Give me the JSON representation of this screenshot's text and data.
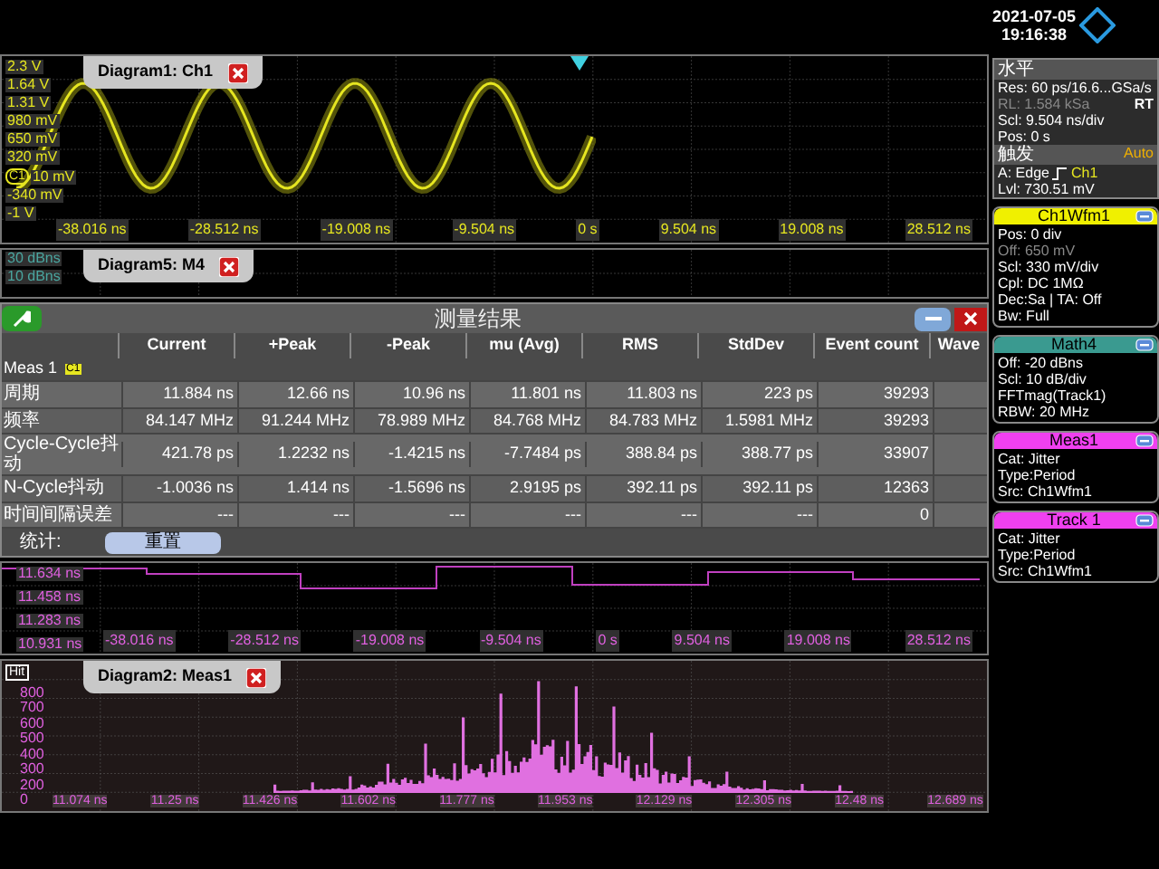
{
  "waveform_diagram": {
    "title": "Diagram1: Ch1",
    "channel_marker": "C1",
    "y_labels": [
      "2.3 V",
      "1.64 V",
      "1.31 V",
      "980 mV",
      "650 mV",
      "320 mV",
      "10 mV",
      "-340 mV",
      "-1 V"
    ],
    "x_labels": [
      "-38.016 ns",
      "-28.512 ns",
      "-19.008 ns",
      "-9.504 ns",
      "0 s",
      "9.504 ns",
      "19.008 ns",
      "28.512 ns"
    ]
  },
  "spectrum_diagram": {
    "title": "Diagram5: M4",
    "y_labels": [
      "30 dBns",
      "10 dBns"
    ]
  },
  "measurement_dialog": {
    "title": "测量结果",
    "columns": [
      "Current",
      "+Peak",
      "-Peak",
      "mu (Avg)",
      "RMS",
      "StdDev",
      "Event count",
      "Wave"
    ],
    "group": "Meas 1",
    "group_badge": "C1",
    "rows": [
      {
        "label": "周期",
        "values": [
          "11.884 ns",
          "12.66 ns",
          "10.96 ns",
          "11.801 ns",
          "11.803 ns",
          "223 ps",
          "39293"
        ]
      },
      {
        "label": "频率",
        "values": [
          "84.147 MHz",
          "91.244 MHz",
          "78.989 MHz",
          "84.768 MHz",
          "84.783 MHz",
          "1.5981 MHz",
          "39293"
        ]
      },
      {
        "label": "Cycle-Cycle抖动",
        "values": [
          "421.78 ps",
          "1.2232 ns",
          "-1.4215 ns",
          "-7.7484 ps",
          "388.84 ps",
          "388.77 ps",
          "33907"
        ]
      },
      {
        "label": "N-Cycle抖动",
        "values": [
          "-1.0036 ns",
          "1.414 ns",
          "-1.5696 ns",
          "2.9195 ps",
          "392.11 ps",
          "392.11 ps",
          "12363"
        ]
      },
      {
        "label": "时间间隔误差",
        "values": [
          "---",
          "---",
          "---",
          "---",
          "---",
          "---",
          "0"
        ]
      }
    ],
    "stats_label": "统计:",
    "reset_button": "重置"
  },
  "track_diagram": {
    "y_labels": [
      "11.634 ns",
      "11.458 ns",
      "11.283 ns",
      "10.931 ns"
    ],
    "x_labels": [
      "-38.016 ns",
      "-28.512 ns",
      "-19.008 ns",
      "-9.504 ns",
      "0 s",
      "9.504 ns",
      "19.008 ns",
      "28.512 ns"
    ]
  },
  "histogram_diagram": {
    "title": "Diagram2: Meas1",
    "axis_badge": "Hit",
    "y_labels": [
      "800",
      "700",
      "600",
      "500",
      "400",
      "300",
      "200",
      "0"
    ],
    "x_labels": [
      "11.074 ns",
      "11.25 ns",
      "11.426 ns",
      "11.602 ns",
      "11.777 ns",
      "11.953 ns",
      "12.129 ns",
      "12.305 ns",
      "12.48 ns",
      "12.689 ns"
    ]
  },
  "side_panel": {
    "date": "2021-07-05",
    "time": "19:16:38",
    "horizontal": {
      "title": "水平",
      "lines": [
        {
          "text": "Res: 60 ps/16.6...GSa/s",
          "disabled": false
        },
        {
          "text": "RL:  1.584 kSa",
          "disabled": true,
          "tag": "RT"
        },
        {
          "text": "Scl:  9.504 ns/div",
          "disabled": false
        },
        {
          "text": "Pos:  0 s",
          "disabled": false
        }
      ]
    },
    "trigger": {
      "title": "触发",
      "mode": "Auto",
      "type": "A:  Edge",
      "source": "Ch1",
      "level": "Lvl:  730.51 mV"
    },
    "boxes": [
      {
        "title": "Ch1Wfm1",
        "color": "#f0f000",
        "lines": [
          {
            "text": "Pos: 0 div",
            "disabled": false
          },
          {
            "text": "Off: 650 mV",
            "disabled": true
          },
          {
            "text": "Scl: 330 mV/div",
            "disabled": false
          },
          {
            "text": "Cpl: DC 1MΩ",
            "disabled": false
          },
          {
            "text": "Dec:Sa | TA: Off",
            "disabled": false
          },
          {
            "text": "Bw: Full",
            "disabled": false
          }
        ]
      },
      {
        "title": "Math4",
        "color": "#3a9a90",
        "lines": [
          {
            "text": "Off:  -20 dBns",
            "disabled": false
          },
          {
            "text": "Scl:  10 dB/div",
            "disabled": false
          },
          {
            "text": "FFTmag(Track1)",
            "disabled": false
          },
          {
            "text": "RBW: 20 MHz",
            "disabled": false
          }
        ]
      },
      {
        "title": "Meas1",
        "color": "#f040f0",
        "lines": [
          {
            "text": "Cat:  Jitter",
            "disabled": false
          },
          {
            "text": "Type:Period",
            "disabled": false
          },
          {
            "text": "Src:  Ch1Wfm1",
            "disabled": false
          }
        ]
      },
      {
        "title": "Track 1",
        "color": "#f040f0",
        "lines": [
          {
            "text": "Cat:  Jitter",
            "disabled": false
          },
          {
            "text": "Type:Period",
            "disabled": false
          },
          {
            "text": "Src:  Ch1Wfm1",
            "disabled": false
          }
        ]
      }
    ]
  }
}
